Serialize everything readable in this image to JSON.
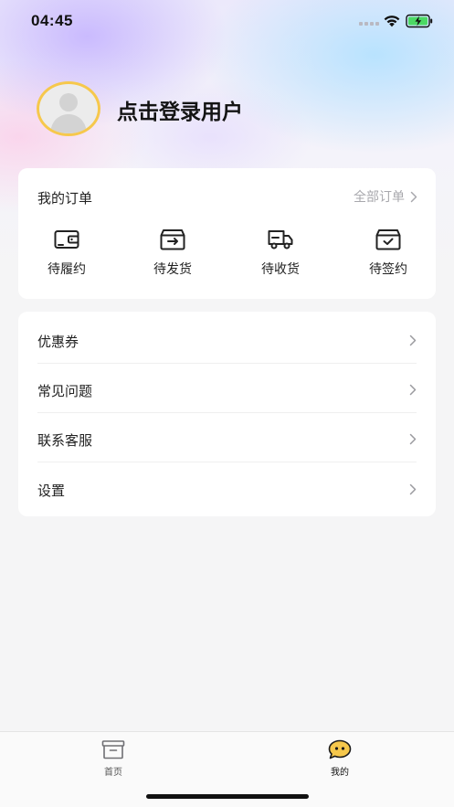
{
  "status_bar": {
    "time": "04:45"
  },
  "profile": {
    "login_label": "点击登录用户"
  },
  "orders": {
    "title": "我的订单",
    "all_label": "全部订单",
    "items": [
      {
        "label": "待履约",
        "icon": "wallet-icon"
      },
      {
        "label": "待发货",
        "icon": "outbox-icon"
      },
      {
        "label": "待收货",
        "icon": "truck-icon"
      },
      {
        "label": "待签约",
        "icon": "inbox-check-icon"
      }
    ]
  },
  "menu": {
    "items": [
      {
        "label": "优惠券"
      },
      {
        "label": "常见问题"
      },
      {
        "label": "联系客服"
      },
      {
        "label": "设置"
      }
    ]
  },
  "tab_bar": {
    "tabs": [
      {
        "label": "首页",
        "icon": "box-icon",
        "active": false
      },
      {
        "label": "我的",
        "icon": "chat-face-icon",
        "active": true
      }
    ]
  },
  "colors": {
    "accent_yellow": "#f6c84c",
    "battery_green": "#4cd964",
    "text_primary": "#222222",
    "text_secondary": "#a8a8ad"
  }
}
